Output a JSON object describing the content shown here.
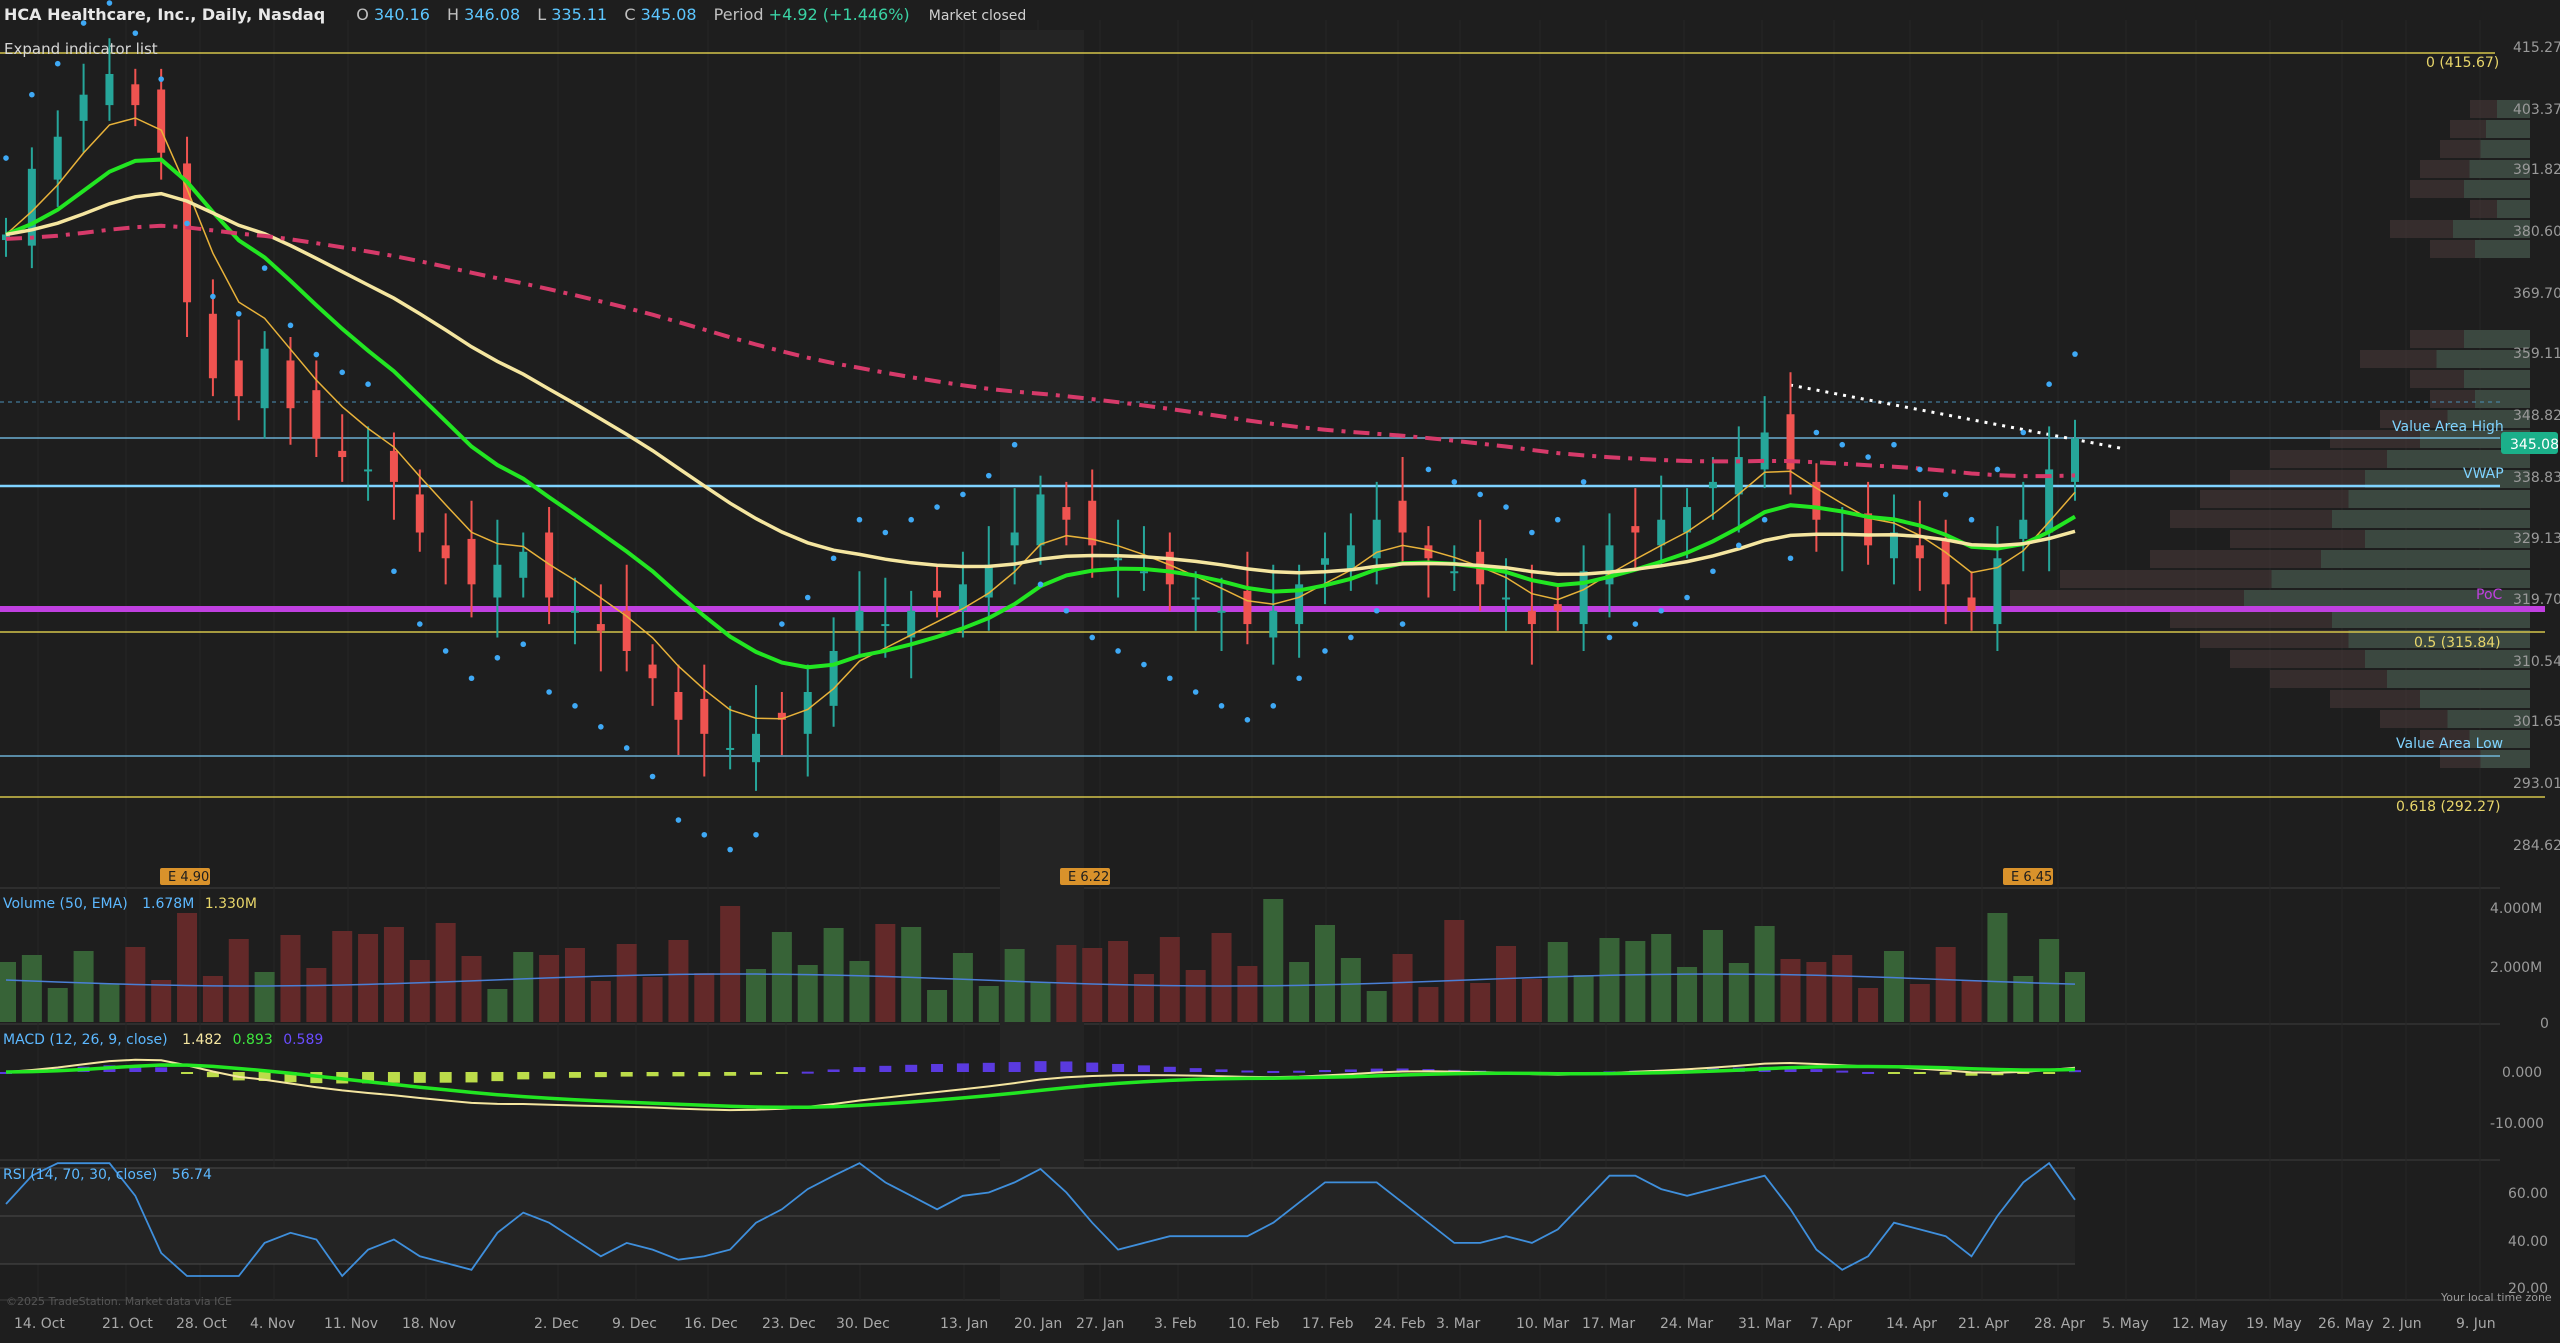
{
  "header": {
    "symbol_title": "HCA Healthcare, Inc., Daily, Nasdaq",
    "open_key": "O",
    "open_value": "340.16",
    "high_key": "H",
    "high_value": "346.08",
    "low_key": "L",
    "low_value": "335.11",
    "close_key": "C",
    "close_value": "345.08",
    "period_key": "Period",
    "period_value": "+4.92 (+1.446%)",
    "market_status": "Market closed"
  },
  "expand_indicator_label": "Expand indicator list",
  "price_axis": {
    "ticks": [
      "415.27",
      "403.37",
      "391.82",
      "380.60",
      "369.70",
      "359.11",
      "348.82",
      "338.83",
      "329.13",
      "319.70",
      "310.54",
      "301.65",
      "293.01",
      "284.62"
    ],
    "last_price_label": "345.08"
  },
  "levels": {
    "fib_0": "0 (415.67)",
    "fib_05": "0.5 (315.84)",
    "fib_0618": "0.618 (292.27)",
    "value_area_high": "Value Area High",
    "vwap": "VWAP",
    "poc": "PoC",
    "value_area_low": "Value Area Low"
  },
  "earnings": [
    "E 4.90",
    "E 6.22",
    "E 6.45"
  ],
  "volume_panel": {
    "title": "Volume (50, EMA)",
    "value1": "1.678M",
    "value2": "1.330M",
    "ticks": [
      "4.000M",
      "2.000M",
      "0"
    ]
  },
  "macd_panel": {
    "title": "MACD (12, 26, 9, close)",
    "value1": "1.482",
    "value2": "0.893",
    "value3": "0.589",
    "ticks": [
      "0.000",
      "-10.000"
    ]
  },
  "rsi_panel": {
    "title": "RSI (14, 70, 30, close)",
    "value": "56.74",
    "ticks": [
      "60.00",
      "40.00",
      "20.00"
    ]
  },
  "x_axis": {
    "labels": [
      "14. Oct",
      "21. Oct",
      "28. Oct",
      "4. Nov",
      "11. Nov",
      "18. Nov",
      "2. Dec",
      "9. Dec",
      "16. Dec",
      "23. Dec",
      "30. Dec",
      "13. Jan",
      "20. Jan",
      "27. Jan",
      "3. Feb",
      "10. Feb",
      "17. Feb",
      "24. Feb",
      "3. Mar",
      "10. Mar",
      "17. Mar",
      "24. Mar",
      "31. Mar",
      "7. Apr",
      "14. Apr",
      "21. Apr",
      "28. Apr",
      "5. May",
      "12. May",
      "19. May",
      "26. May",
      "2. Jun",
      "9. Jun"
    ]
  },
  "footer": {
    "copyright": "©2025 TradeStation. Market data via ICE",
    "timezone": "Your local time zone"
  },
  "colors": {
    "background": "#1e1e1e",
    "up_candle": "#26a69a",
    "down_candle": "#ef5350",
    "fast_ma": "#22e622",
    "slow_ma": "#f5e6a0",
    "poc_line": "#c040e0",
    "vwap_line": "#7fd3ff",
    "sar_dots": "#3fa9f5",
    "fib_line": "#d4c44a"
  },
  "chart_data": {
    "type": "candlestick",
    "title": "HCA Healthcare, Inc., Daily, Nasdaq",
    "price_range": [
      284.62,
      415.27
    ],
    "x_range": [
      "14. Oct",
      "9. Jun"
    ],
    "close_series_estimate": [
      380,
      392,
      398,
      406,
      410,
      404,
      395,
      368,
      355,
      352,
      360,
      350,
      345,
      342,
      340,
      338,
      330,
      326,
      322,
      325,
      327,
      320,
      318,
      315,
      312,
      308,
      302,
      300,
      298,
      300,
      302,
      306,
      312,
      318,
      316,
      318,
      320,
      322,
      325,
      330,
      336,
      332,
      328,
      326,
      324,
      322,
      320,
      318,
      316,
      318,
      322,
      326,
      328,
      332,
      330,
      326,
      324,
      322,
      320,
      316,
      318,
      324,
      328,
      330,
      332,
      334,
      338,
      342,
      346,
      340,
      332,
      330,
      328,
      330,
      326,
      322,
      318,
      326,
      332,
      340,
      345.08
    ],
    "last_close": 345.08,
    "fib_levels": {
      "0": 415.67,
      "0.5": 315.84,
      "0.618": 292.27
    },
    "volume_ylim": [
      0,
      4000000
    ],
    "rsi_last": 56.74
  }
}
